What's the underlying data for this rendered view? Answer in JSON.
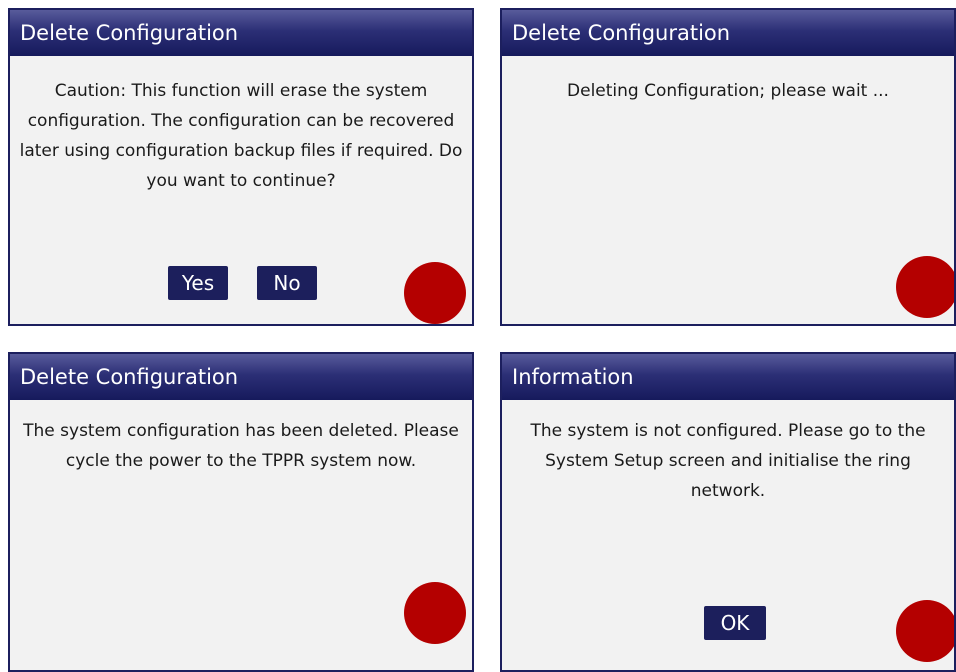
{
  "panels": [
    {
      "title": "Delete Configuration",
      "message": "Caution: This function will erase the system configuration. The configuration can be recovered later using configuration backup files if required. Do you want to continue?",
      "buttons": [
        "Yes",
        "No"
      ]
    },
    {
      "title": "Delete Configuration",
      "message": "Deleting Configuration; please wait ..."
    },
    {
      "title": "Delete Configuration",
      "message": "The system configuration has been deleted. Please cycle the power to the TPPR system now."
    },
    {
      "title": "Information",
      "message": "The system is not configured. Please go to the System Setup screen and initialise the ring network.",
      "buttons": [
        "OK"
      ]
    }
  ],
  "colors": {
    "title_bar": "#1c1f5e",
    "button": "#1c1f5c",
    "indicator": "#b40000",
    "panel_background": "#f2f2f2"
  }
}
